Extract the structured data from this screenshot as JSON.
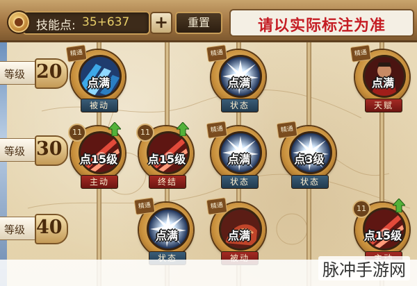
{
  "header": {
    "skill_points_label": "技能点:",
    "skill_points_value": "35+637",
    "plus_label": "+",
    "reset_label": "重置",
    "notice": "请以实际标注为准"
  },
  "levels": [
    {
      "label": "等级",
      "number": "20"
    },
    {
      "label": "等级",
      "number": "30"
    },
    {
      "label": "等级",
      "number": "40"
    }
  ],
  "nodes": [
    {
      "mastery": "精通",
      "text": "点满",
      "tag": "被动",
      "tag_color": "blue",
      "art": "blue-claw",
      "level_badge": "",
      "upgradable": false
    },
    {
      "mastery": "精通",
      "text": "点满",
      "tag": "状态",
      "tag_color": "blue",
      "art": "burst",
      "level_badge": "",
      "upgradable": false
    },
    {
      "mastery": "精通",
      "text": "点满",
      "tag": "天赋",
      "tag_color": "red",
      "art": "warrior",
      "level_badge": "",
      "upgradable": false
    },
    {
      "mastery": "",
      "text": "点15级",
      "tag": "主动",
      "tag_color": "red",
      "art": "red-slash",
      "level_badge": "11",
      "upgradable": true
    },
    {
      "mastery": "",
      "text": "点15级",
      "tag": "终结",
      "tag_color": "red",
      "art": "red-slash",
      "level_badge": "11",
      "upgradable": true
    },
    {
      "mastery": "精通",
      "text": "点满",
      "tag": "状态",
      "tag_color": "blue",
      "art": "burst",
      "level_badge": "",
      "upgradable": false
    },
    {
      "mastery": "精通",
      "text": "点3级",
      "tag": "状态",
      "tag_color": "blue",
      "art": "burst",
      "level_badge": "",
      "upgradable": false
    },
    {
      "mastery": "精通",
      "text": "点满",
      "tag": "状态",
      "tag_color": "blue",
      "art": "burst",
      "level_badge": "",
      "upgradable": false
    },
    {
      "mastery": "精通",
      "text": "点满",
      "tag": "被动",
      "tag_color": "red",
      "art": "red-cloak",
      "level_badge": "",
      "upgradable": false
    },
    {
      "mastery": "",
      "text": "点15级",
      "tag": "主动",
      "tag_color": "red",
      "art": "red-slash",
      "level_badge": "11",
      "upgradable": true
    }
  ],
  "watermark": "脉冲手游网",
  "colors": {
    "notice_red": "#c51d24",
    "points_gold": "#e7cd68",
    "upgrade_green": "#53b23a"
  }
}
